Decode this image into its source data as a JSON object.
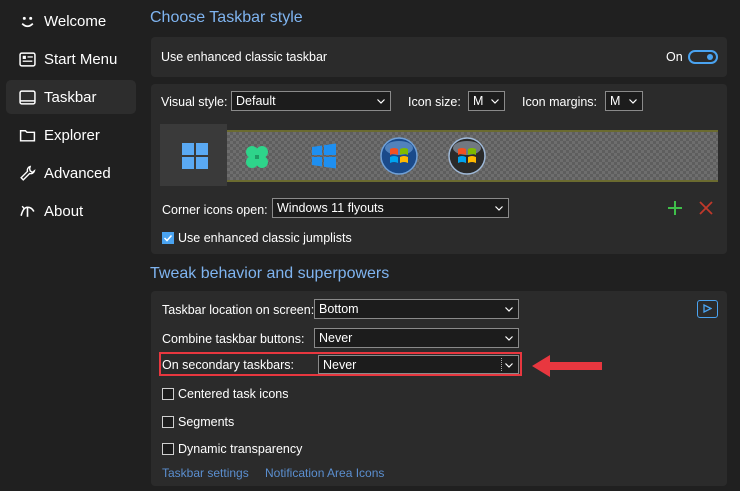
{
  "sidebar": {
    "items": [
      {
        "label": "Welcome",
        "icon": "smile-icon"
      },
      {
        "label": "Start Menu",
        "icon": "start-menu-icon"
      },
      {
        "label": "Taskbar",
        "icon": "taskbar-icon",
        "selected": true
      },
      {
        "label": "Explorer",
        "icon": "folder-icon"
      },
      {
        "label": "Advanced",
        "icon": "wrench-icon"
      },
      {
        "label": "About",
        "icon": "about-icon"
      }
    ]
  },
  "style_section": {
    "title": "Choose Taskbar style",
    "enhanced_label": "Use enhanced classic taskbar",
    "enhanced_state": "On",
    "visual_style_label": "Visual style:",
    "visual_style_value": "Default",
    "icon_size_label": "Icon size:",
    "icon_size_value": "M",
    "icon_margins_label": "Icon margins:",
    "icon_margins_value": "M",
    "corner_icons_label": "Corner icons open:",
    "corner_icons_value": "Windows 11 flyouts",
    "jumplists_label": "Use enhanced classic jumplists",
    "jumplists_checked": true,
    "style_tiles": [
      "windows11-logo-icon",
      "clover-logo-icon",
      "windows10-logo-icon",
      "windows7-orb-icon",
      "windows-vista-orb-icon"
    ]
  },
  "behavior_section": {
    "title": "Tweak behavior and superpowers",
    "location_label": "Taskbar location on screen:",
    "location_value": "Bottom",
    "combine_label": "Combine taskbar buttons:",
    "combine_value": "Never",
    "secondary_label": "On secondary taskbars:",
    "secondary_value": "Never",
    "centered_label": "Centered task icons",
    "segments_label": "Segments",
    "transparency_label": "Dynamic transparency",
    "link_taskbar_settings": "Taskbar settings",
    "link_notification": "Notification Area Icons"
  },
  "colors": {
    "accent": "#4aa3f0",
    "highlight_red": "#e8373f",
    "add_green": "#3fbf4a",
    "remove_red": "#c0392b"
  }
}
